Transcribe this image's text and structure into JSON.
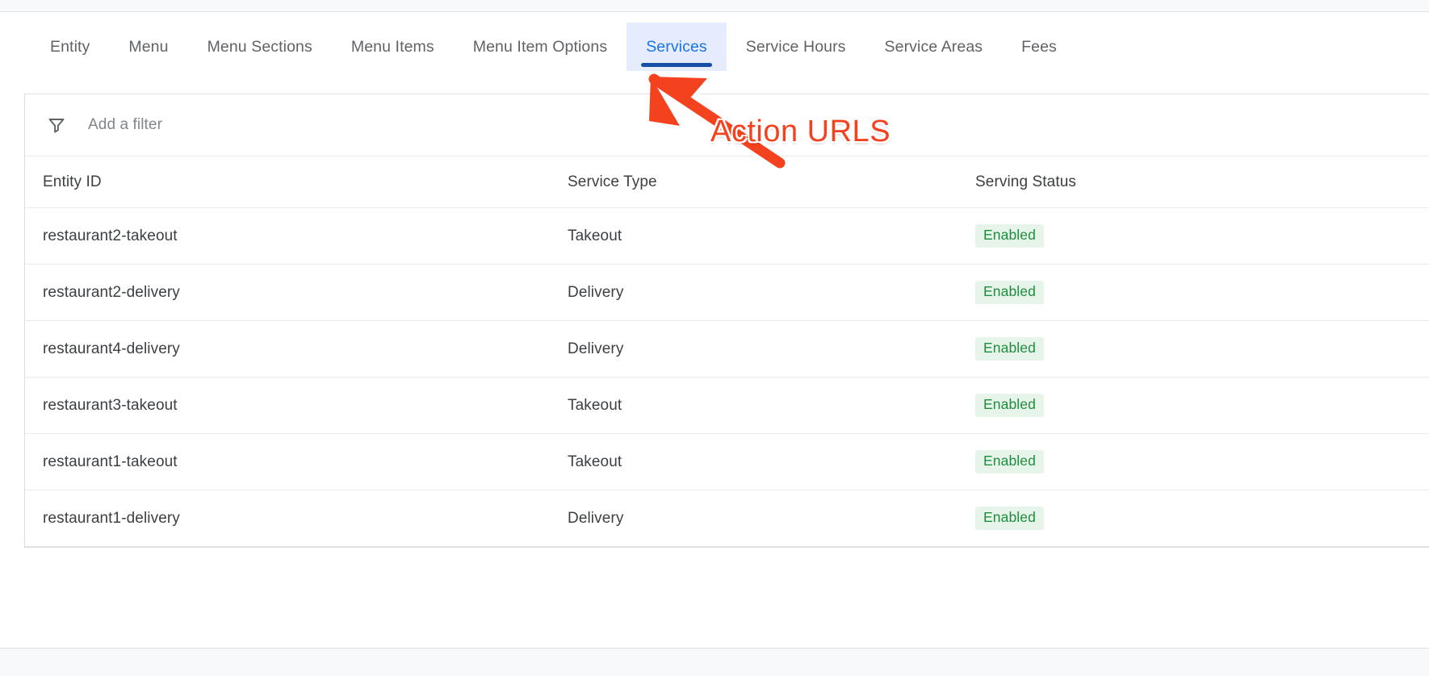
{
  "tabs": [
    {
      "label": "Entity",
      "active": false
    },
    {
      "label": "Menu",
      "active": false
    },
    {
      "label": "Menu Sections",
      "active": false
    },
    {
      "label": "Menu Items",
      "active": false
    },
    {
      "label": "Menu Item Options",
      "active": false
    },
    {
      "label": "Services",
      "active": true
    },
    {
      "label": "Service Hours",
      "active": false
    },
    {
      "label": "Service Areas",
      "active": false
    },
    {
      "label": "Fees",
      "active": false
    }
  ],
  "filter": {
    "icon": "filter-funnel-icon",
    "placeholder": "Add a filter",
    "value": ""
  },
  "table": {
    "columns": [
      "Entity ID",
      "Service Type",
      "Serving Status"
    ],
    "rows": [
      {
        "entity_id": "restaurant2-takeout",
        "service_type": "Takeout",
        "serving_status": "Enabled"
      },
      {
        "entity_id": "restaurant2-delivery",
        "service_type": "Delivery",
        "serving_status": "Enabled"
      },
      {
        "entity_id": "restaurant4-delivery",
        "service_type": "Delivery",
        "serving_status": "Enabled"
      },
      {
        "entity_id": "restaurant3-takeout",
        "service_type": "Takeout",
        "serving_status": "Enabled"
      },
      {
        "entity_id": "restaurant1-takeout",
        "service_type": "Takeout",
        "serving_status": "Enabled"
      },
      {
        "entity_id": "restaurant1-delivery",
        "service_type": "Delivery",
        "serving_status": "Enabled"
      }
    ]
  },
  "annotation": {
    "text": "Action URLS",
    "arrow": "arrow-pointing-up-left-icon",
    "color": "#f4411e"
  },
  "colors": {
    "accent": "#1a73e8",
    "active_tab_bg": "#e4ecfd",
    "active_tab_underline": "#174ea6",
    "badge_bg": "#e6f4ea",
    "badge_text": "#1e8e3e",
    "text_primary": "#3c4043",
    "text_secondary": "#5f6368",
    "placeholder": "#80868b",
    "border": "#e8eaed",
    "page_bg": "#f8f9fa"
  }
}
